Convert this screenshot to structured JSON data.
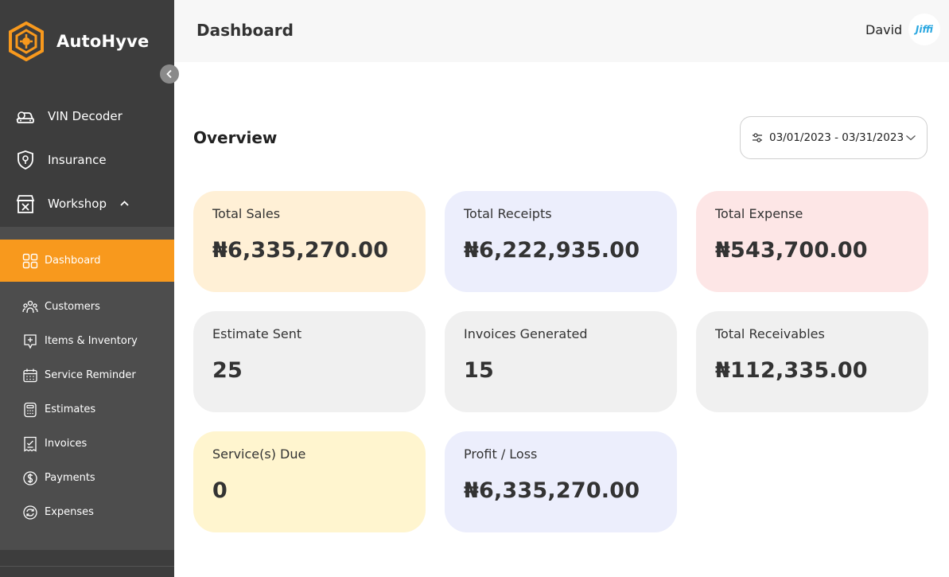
{
  "brand": {
    "name": "AutoHyve"
  },
  "header": {
    "title": "Dashboard",
    "user_name": "David",
    "avatar_text": "Jiffi"
  },
  "main_nav": [
    {
      "label": "VIN Decoder",
      "icon": "car-search-icon"
    },
    {
      "label": "Insurance",
      "icon": "shield-pin-icon"
    },
    {
      "label": "Workshop",
      "icon": "workshop-icon",
      "expanded": true
    }
  ],
  "sub_nav": [
    {
      "label": "Dashboard",
      "icon": "grid-icon",
      "active": true
    },
    {
      "label": "Customers",
      "icon": "people-icon"
    },
    {
      "label": "Items & Inventory",
      "icon": "inventory-icon"
    },
    {
      "label": "Service Reminder",
      "icon": "calendar-icon"
    },
    {
      "label": "Estimates",
      "icon": "calculator-icon"
    },
    {
      "label": "Invoices",
      "icon": "invoice-icon"
    },
    {
      "label": "Payments",
      "icon": "dollar-icon"
    },
    {
      "label": "Expenses",
      "icon": "refresh-icon"
    }
  ],
  "overview": {
    "title": "Overview",
    "date_range": "03/01/2023 - 03/31/2023"
  },
  "cards": [
    {
      "label": "Total Sales",
      "value": "₦6,335,270.00",
      "color": "#fff0d6"
    },
    {
      "label": "Total Receipts",
      "value": "₦6,222,935.00",
      "color": "#eceefc"
    },
    {
      "label": "Total Expense",
      "value": "₦543,700.00",
      "color": "#fde6e6"
    },
    {
      "label": "Estimate Sent",
      "value": "25",
      "color": "#f0f0f0"
    },
    {
      "label": "Invoices Generated",
      "value": "15",
      "color": "#f0f0f0"
    },
    {
      "label": "Total Receivables",
      "value": "₦112,335.00",
      "color": "#f0f0f0"
    },
    {
      "label": "Service(s) Due",
      "value": "0",
      "color": "#fff5cf"
    },
    {
      "label": "Profit / Loss",
      "value": "₦6,335,270.00",
      "color": "#eceefc"
    }
  ],
  "colors": {
    "sidebar": "#3d3d3d",
    "subnav": "#4d4d4d",
    "accent": "#f8991d"
  }
}
